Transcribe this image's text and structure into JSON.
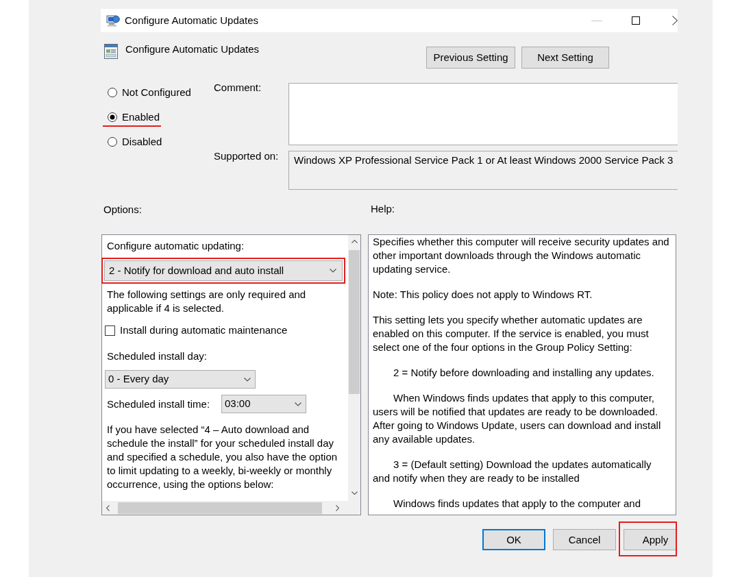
{
  "window": {
    "title": "Configure Automatic Updates"
  },
  "header": {
    "setting_title": "Configure Automatic Updates",
    "buttons": [
      {
        "label": "Previous Setting"
      },
      {
        "label": "Next Setting"
      }
    ]
  },
  "states": [
    {
      "label": "Not Configured",
      "selected": false,
      "highlighted": false
    },
    {
      "label": "Enabled",
      "selected": true,
      "highlighted": true
    },
    {
      "label": "Disabled",
      "selected": false,
      "highlighted": false
    }
  ],
  "comment": {
    "label": "Comment:"
  },
  "supported_on": {
    "label": "Supported on:",
    "value": "Windows XP Professional Service Pack 1 or At least Windows 2000 Service Pack 3"
  },
  "options": {
    "label": "Options:",
    "update_mode": {
      "label": "Configure automatic updating:",
      "value": "2 - Notify for download and auto install",
      "highlighted": true
    },
    "note": "The following settings are only required and applicable if 4 is selected.",
    "maintenance": {
      "label": "Install during automatic maintenance",
      "checked": false
    },
    "install_day": {
      "label": "Scheduled install day:",
      "value": "0 - Every day"
    },
    "install_time": {
      "label": "Scheduled install time:",
      "value": "03:00"
    },
    "schedule_note": "If you have selected “4 – Auto download and schedule the install” for your scheduled install day and specified a schedule, you also have the option to limit updating to a weekly, bi-weekly or monthly occurrence, using the options below:"
  },
  "help": {
    "label": "Help:",
    "paragraphs": [
      {
        "text": "Specifies whether this computer will receive security updates and other important downloads through the Windows automatic updating service.",
        "indented": false
      },
      {
        "text": "Note: This policy does not apply to Windows RT.",
        "indented": false
      },
      {
        "text": "This setting lets you specify whether automatic updates are enabled on this computer. If the service is enabled, you must select one of the four options in the Group Policy Setting:",
        "indented": false
      },
      {
        "text": "2 = Notify before downloading and installing any updates.",
        "indented": true
      },
      {
        "text": "When Windows finds updates that apply to this computer, users will be notified that updates are ready to be downloaded. After going to Windows Update, users can download and install any available updates.",
        "indented": true
      },
      {
        "text": "3 = (Default setting) Download the updates automatically and notify when they are ready to be installed",
        "indented": true
      },
      {
        "text": "Windows finds updates that apply to the computer and",
        "indented": true
      }
    ]
  },
  "footer_buttons": [
    {
      "label": "OK",
      "default": true,
      "highlighted": false
    },
    {
      "label": "Cancel",
      "default": false,
      "highlighted": false
    },
    {
      "label": "Apply",
      "default": false,
      "highlighted": true
    }
  ]
}
